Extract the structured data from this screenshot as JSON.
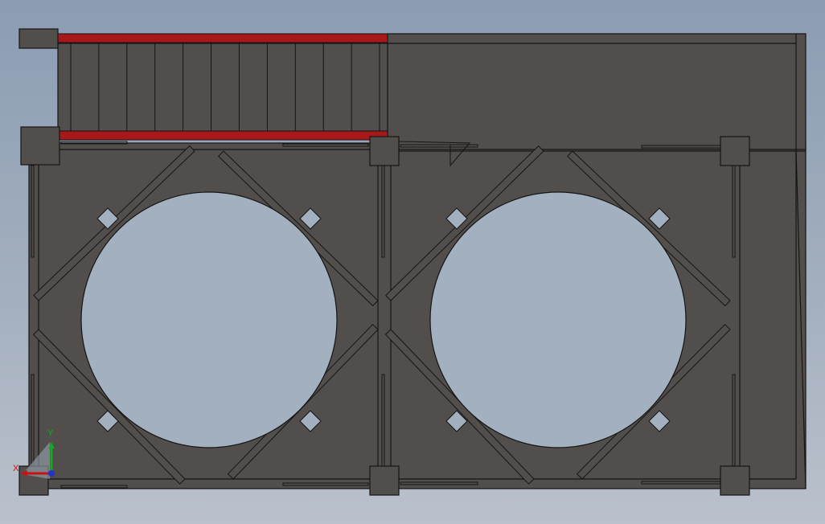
{
  "view": {
    "background_top": "#8b9cb3",
    "background_bottom": "#bac1cc",
    "steel_color": "#524e4b",
    "edge_color": "#151515",
    "rail_color": "#a81818",
    "opening_color": "#a3b0bf"
  },
  "drawing": {
    "grating_bays": 12,
    "openings": 2,
    "bolt_plates_per_bay": 4
  },
  "triad": {
    "x_label": "X",
    "y_label": "Y",
    "x_color": "#cc1111",
    "y_color": "#11aa22",
    "z_color": "#2233cc"
  }
}
